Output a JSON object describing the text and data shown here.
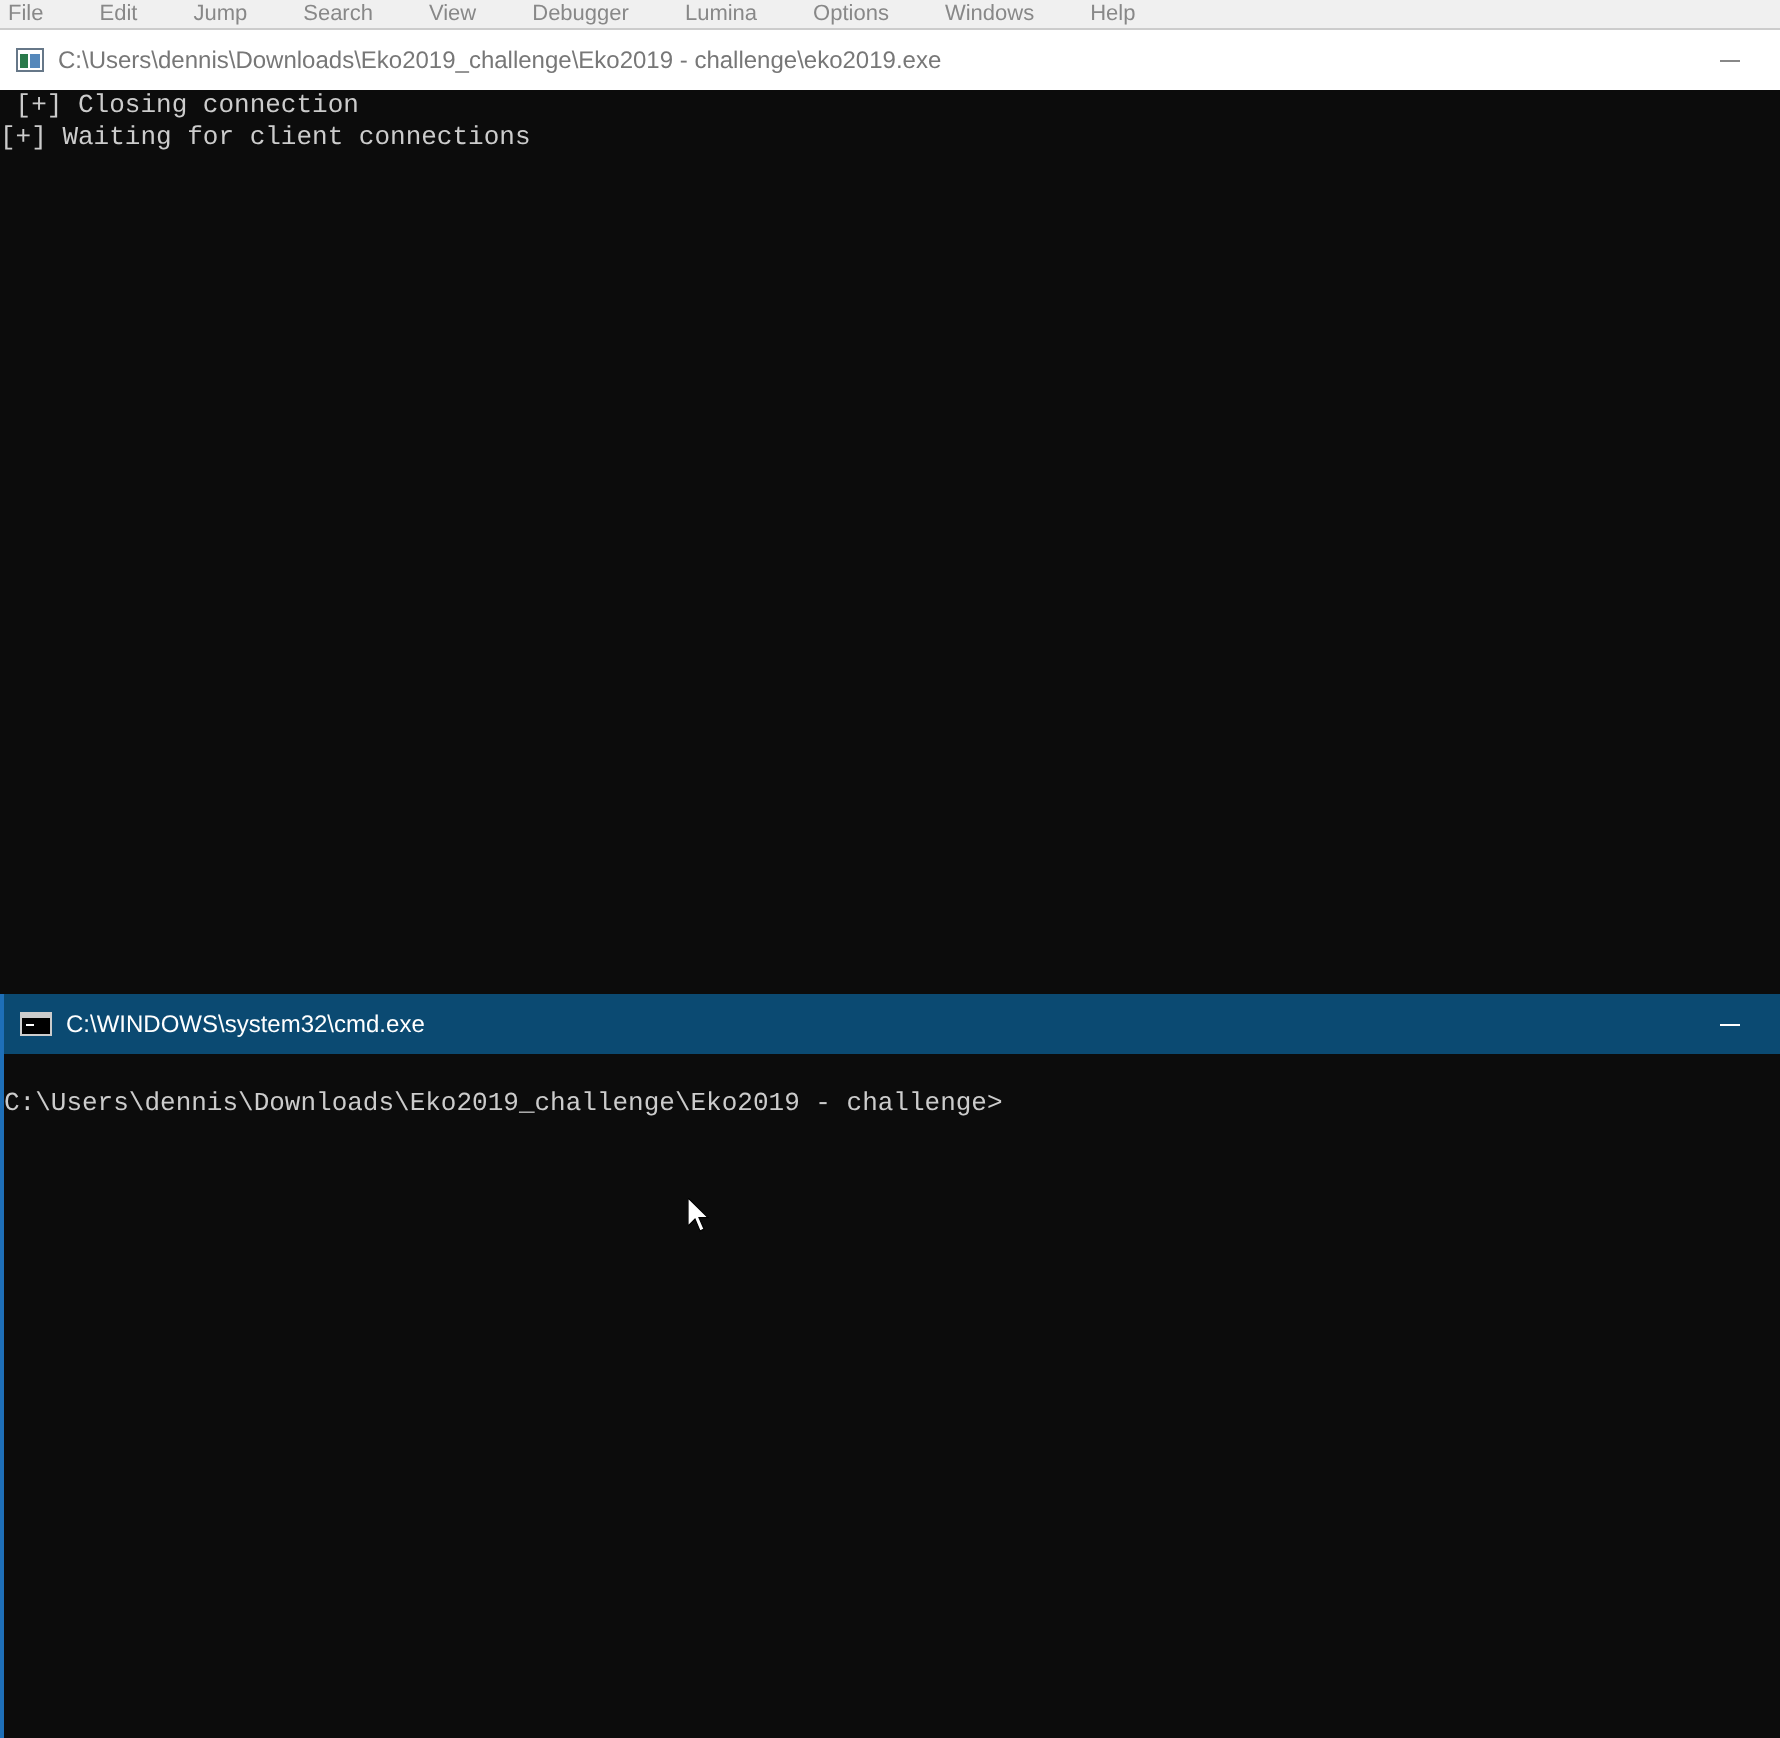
{
  "menu_bar": {
    "items": [
      "File",
      "Edit",
      "Jump",
      "Search",
      "View",
      "Debugger",
      "Lumina",
      "Options",
      "Windows",
      "Help"
    ]
  },
  "windows": [
    {
      "kind": "console",
      "title": "C:\\Users\\dennis\\Downloads\\Eko2019_challenge\\Eko2019 - challenge\\eko2019.exe",
      "active": false,
      "lines": [
        " [+] Closing connection",
        "[+] Waiting for client connections"
      ]
    },
    {
      "kind": "cmd",
      "title": "C:\\WINDOWS\\system32\\cmd.exe",
      "active": true,
      "lines": [
        "C:\\Users\\dennis\\Downloads\\Eko2019_challenge\\Eko2019 - challenge>"
      ]
    }
  ]
}
